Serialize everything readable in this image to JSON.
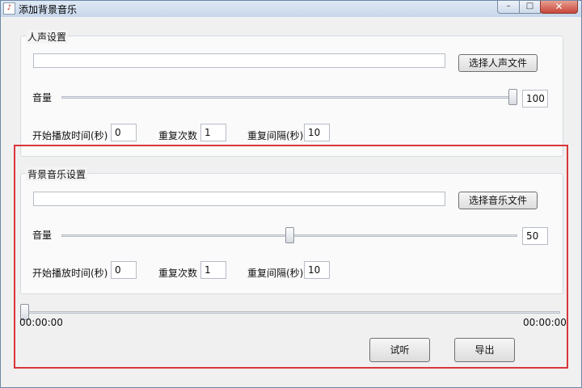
{
  "window": {
    "title": "添加背景音乐",
    "app_icon": "music-note-icon"
  },
  "voice": {
    "legend": "人声设置",
    "path_value": "",
    "choose_label": "选择人声文件",
    "volume_label": "音量",
    "volume_value": "100",
    "volume_fraction": 1.0,
    "start_time_label": "开始播放时间(秒)",
    "start_time_value": "0",
    "repeat_count_label": "重复次数",
    "repeat_count_value": "1",
    "repeat_interval_label": "重复间隔(秒)",
    "repeat_interval_value": "10"
  },
  "bgm": {
    "legend": "背景音乐设置",
    "path_value": "",
    "choose_label": "选择音乐文件",
    "volume_label": "音量",
    "volume_value": "50",
    "volume_fraction": 0.5,
    "start_time_label": "开始播放时间(秒)",
    "start_time_value": "0",
    "repeat_count_label": "重复次数",
    "repeat_count_value": "1",
    "repeat_interval_label": "重复间隔(秒)",
    "repeat_interval_value": "10"
  },
  "timeline": {
    "current": "00:00:00",
    "total": "00:00:00",
    "progress_fraction": 0.0
  },
  "actions": {
    "preview_label": "试听",
    "export_label": "导出"
  },
  "colors": {
    "highlight_frame": "#d9363b"
  }
}
